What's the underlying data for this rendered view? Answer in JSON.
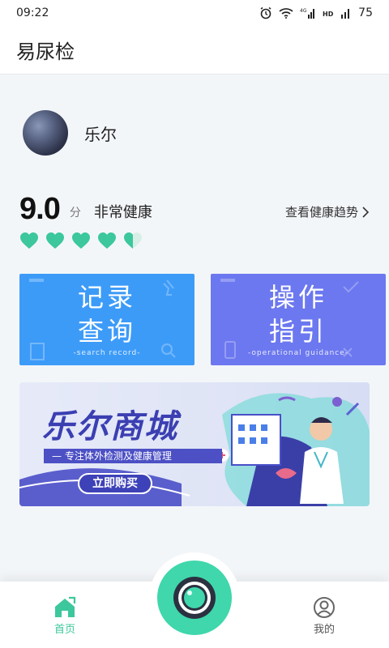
{
  "status_bar": {
    "time": "09:22",
    "battery": "75"
  },
  "app": {
    "title": "易尿检"
  },
  "profile": {
    "name": "乐尔"
  },
  "health": {
    "score": "9.0",
    "unit": "分",
    "status": "非常健康",
    "trend_link": "查看健康趋势",
    "rating": 4.5,
    "rating_max": 5
  },
  "cards": {
    "record": {
      "title_line1": "记录",
      "title_line2": "查询",
      "subtitle": "-search record-"
    },
    "guide": {
      "title_line1": "操作",
      "title_line2": "指引",
      "subtitle": "-operational guidance-"
    }
  },
  "banner": {
    "title": "乐尔商城",
    "slogan": "— 专注体外检测及健康管理",
    "button": "立即购买"
  },
  "tabbar": {
    "home": "首页",
    "mine": "我的"
  },
  "colors": {
    "accent": "#3fd7ab",
    "heart": "#3cc79c",
    "record_card": "#3d9bf8",
    "guide_card": "#6c78ef",
    "banner_text": "#3b3fb2"
  }
}
